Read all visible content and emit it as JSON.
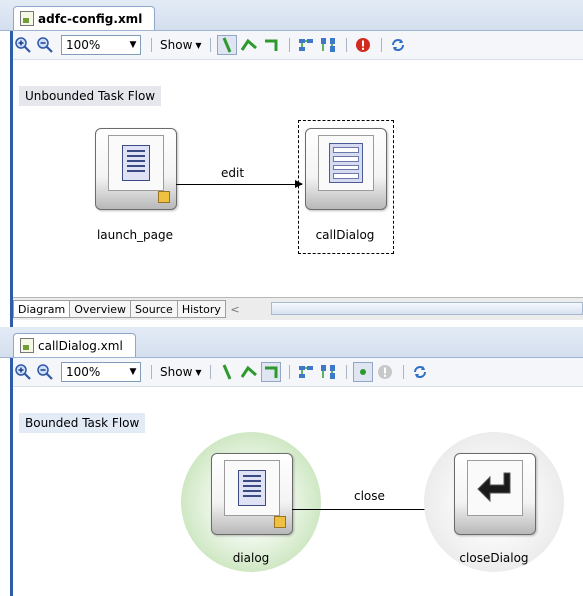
{
  "top_editor": {
    "file_tab": "adfc-config.xml",
    "zoom": "100%",
    "show_label": "Show",
    "flow_label": "Unbounded Task Flow",
    "nodes": {
      "launch": "launch_page",
      "dialog": "callDialog"
    },
    "edge_label": "edit",
    "bottom_tabs": [
      "Diagram",
      "Overview",
      "Source",
      "History"
    ]
  },
  "bottom_editor": {
    "file_tab": "callDialog.xml",
    "zoom": "100%",
    "show_label": "Show",
    "flow_label": "Bounded Task Flow",
    "nodes": {
      "dialog": "dialog",
      "close": "closeDialog"
    },
    "edge_label": "close"
  },
  "icons": {
    "zoom_in": "zoom-in-icon",
    "zoom_out": "zoom-out-icon",
    "control_flow": "control-flow-icon",
    "wildcard_flow": "wildcard-flow-icon",
    "return_flow": "return-flow-icon",
    "layout_h": "layout-horizontal-icon",
    "layout_v": "layout-vertical-icon",
    "error": "error-icon",
    "refresh": "refresh-icon"
  },
  "colors": {
    "accent": "#2d5ca8",
    "flow_green": "#2e9a2e",
    "error_red": "#d22a1e",
    "default_glow": "#cfe8c4",
    "exit_glow": "#e2e2e2"
  }
}
